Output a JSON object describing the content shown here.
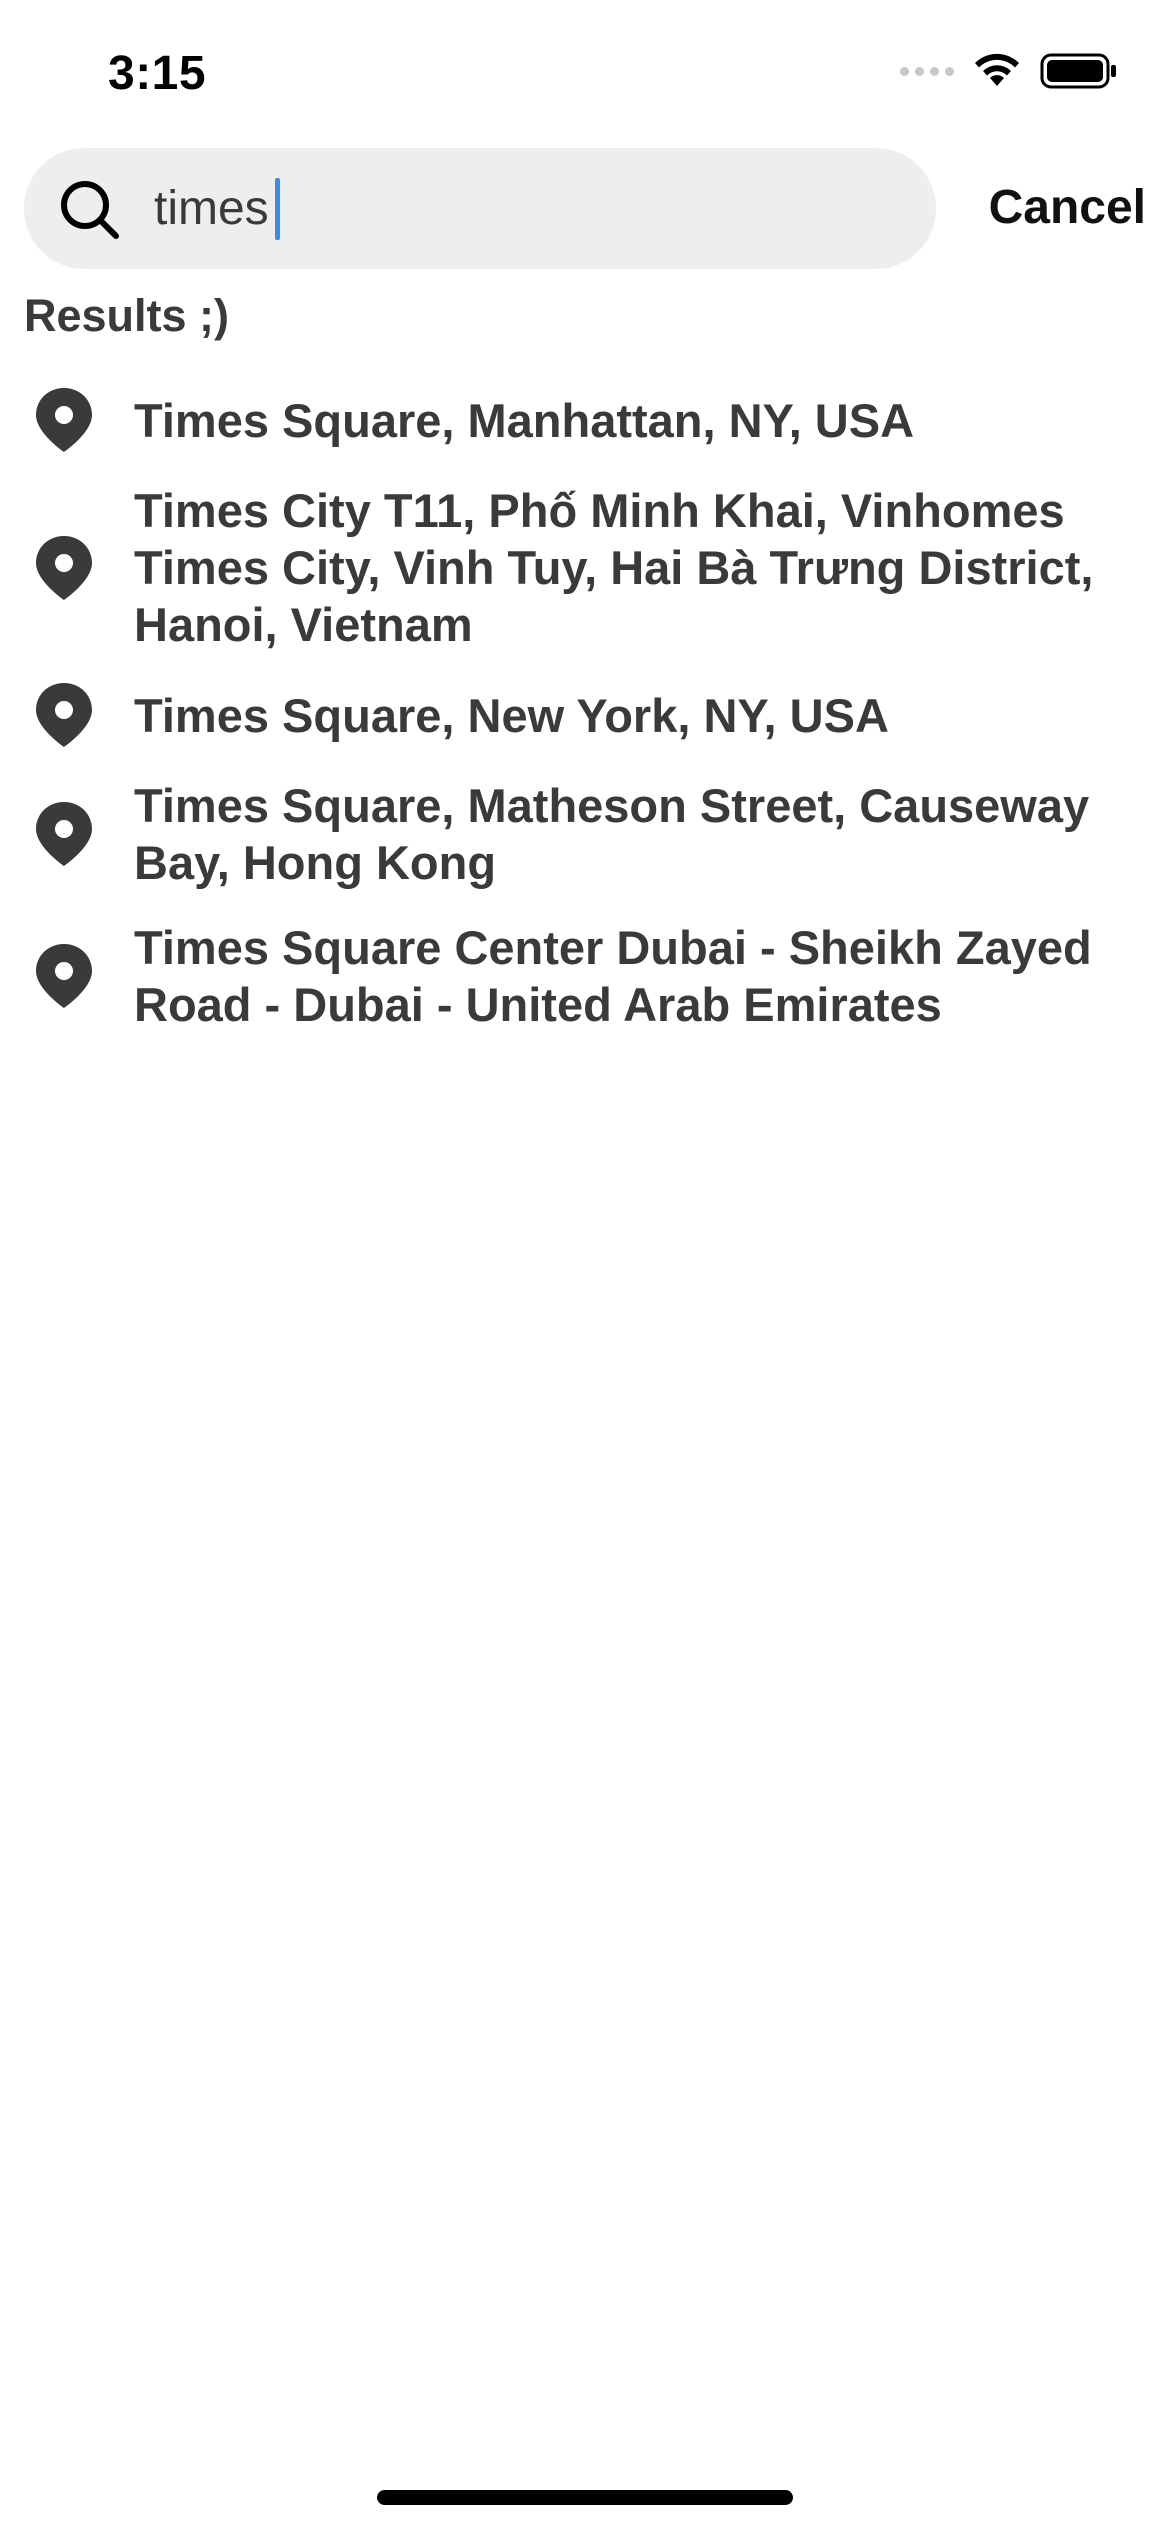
{
  "status_bar": {
    "time": "3:15",
    "icons": [
      "signal-icon",
      "wifi-icon",
      "battery-icon"
    ]
  },
  "search": {
    "value": "times",
    "cancel_label": "Cancel",
    "icon": "search-icon"
  },
  "results": {
    "title": "Results ;)",
    "items": [
      {
        "label": "Times Square, Manhattan, NY, USA",
        "icon": "map-pin-icon"
      },
      {
        "label": "Times City T11, Phố Minh Khai, Vinhomes Times City, Vinh Tuy, Hai Bà Trưng District, Hanoi, Vietnam",
        "icon": "map-pin-icon"
      },
      {
        "label": "Times Square, New York, NY, USA",
        "icon": "map-pin-icon"
      },
      {
        "label": "Times Square, Matheson Street, Causeway Bay, Hong Kong",
        "icon": "map-pin-icon"
      },
      {
        "label": "Times Square Center Dubai - Sheikh Zayed Road - Dubai - United Arab Emirates",
        "icon": "map-pin-icon"
      }
    ]
  },
  "colors": {
    "search_bg": "#eeeeee",
    "caret": "#3a8ee6",
    "text": "#3a3a3c",
    "pin": "#3a3a3c"
  }
}
